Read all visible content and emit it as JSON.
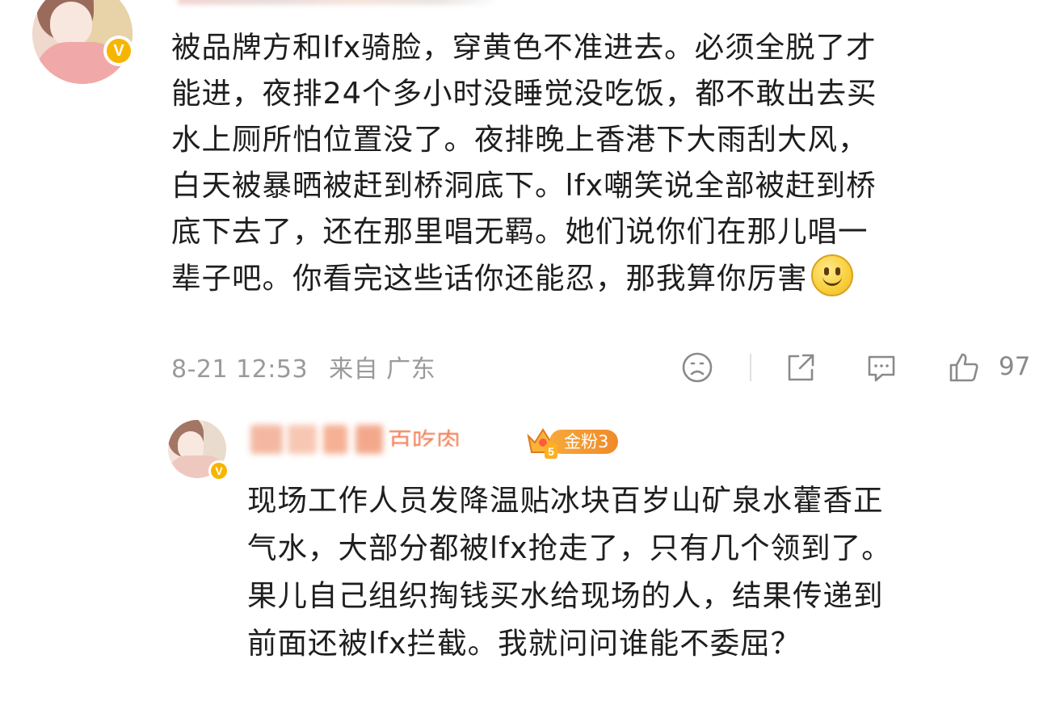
{
  "top_comment": {
    "avatar_icon": "user-avatar-icon",
    "verified_badge": "V",
    "lines": [
      "被品牌方和lfx骑脸，穿黄色不准进去。必须全脱了才",
      "能进，夜排24个多小时没睡觉没吃饭，都不敢出去买",
      "水上厕所怕位置没了。夜排晚上香港下大雨刮大风，",
      "白天被暴晒被赶到桥洞底下。lfx嘲笑说全部被赶到桥",
      "底下去了，还在那里唱无羁。她们说你们在那儿唱一",
      "辈子吧。你看完这些话你还能忍，那我算你厉害"
    ],
    "emoji": "smile-emoji",
    "time": "8-21 12:53",
    "source": "来自 广东",
    "actions": {
      "sad_icon": "sad-face-icon",
      "share_icon": "share-icon",
      "comment_icon": "comment-icon",
      "like_icon": "thumbs-up-icon",
      "like_count": "97"
    }
  },
  "reply": {
    "avatar_icon": "user-avatar-icon",
    "verified_badge": "V",
    "name_visible_fragment": "百吃肉",
    "fan_badge": {
      "label": "金粉3",
      "level": "5",
      "color": "#f39a2e"
    },
    "lines": [
      "现场工作人员发降温贴冰块百岁山矿泉水藿香正",
      "气水，大部分都被lfx抢走了，只有几个领到了。",
      "果儿自己组织掏钱买水给现场的人，结果传递到",
      "前面还被lfx拦截。我就问问谁能不委屈？"
    ]
  },
  "colors": {
    "text": "#1e1e1e",
    "meta": "#9a9a9a",
    "verified": "#f7b500",
    "fan_badge": "#f39a2e"
  }
}
